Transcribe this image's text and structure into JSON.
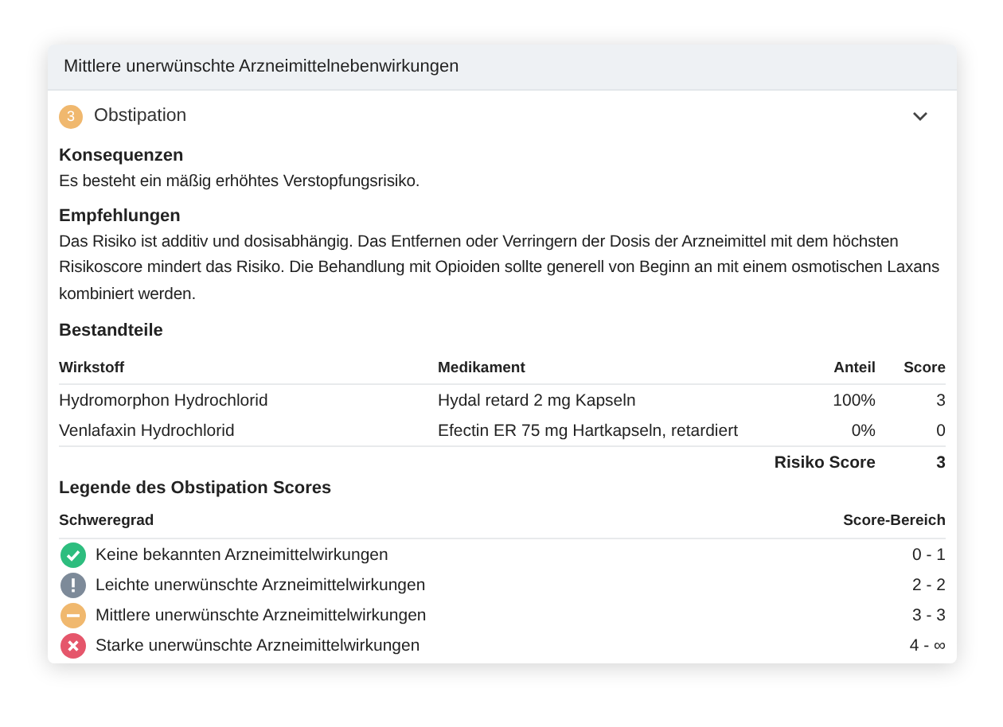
{
  "card": {
    "title": "Mittlere unerwünschte Arzneimittelnebenwirkungen"
  },
  "item": {
    "badge": "3",
    "title": "Obstipation",
    "expanded": true
  },
  "sections": [
    {
      "heading": "Konsequenzen",
      "text": "Es besteht ein mäßig erhöhtes Verstopfungsrisiko."
    },
    {
      "heading": "Empfehlungen",
      "text": "Das Risiko ist additiv und dosisabhängig. Das Entfernen oder Verringern der Dosis der Arzneimittel mit dem höchsten Risikoscore mindert das Risiko. Die Behandlung mit Opioiden sollte generell von Beginn an mit einem osmotischen Laxans kombiniert werden."
    }
  ],
  "components": {
    "heading": "Bestandteile",
    "columns": [
      "Wirkstoff",
      "Medikament",
      "Anteil",
      "Score"
    ],
    "rows": [
      [
        "Hydromorphon Hydrochlorid",
        "Hydal retard 2 mg Kapseln",
        "100%",
        "3"
      ],
      [
        "Venlafaxin Hydrochlorid",
        "Efectin ER 75 mg Hartkapseln, retardiert",
        "0%",
        "0"
      ]
    ],
    "total_label": "Risiko Score",
    "total": "3"
  },
  "legend": {
    "heading": "Legende des Obstipation Scores",
    "columns": [
      "Schweregrad",
      "Score-Bereich"
    ],
    "rows": [
      {
        "kind": "check",
        "color": "#2dbd7e",
        "label": "Keine bekannten Arzneimittelwirkungen",
        "range": "0 - 1"
      },
      {
        "kind": "exclamation",
        "color": "#7d8a99",
        "label": "Leichte unerwünschte Arzneimittelwirkungen",
        "range": "2 - 2"
      },
      {
        "kind": "minus",
        "color": "#f0b86e",
        "label": "Mittlere unerwünschte Arzneimittelwirkungen",
        "range": "3 - 3"
      },
      {
        "kind": "cross",
        "color": "#e5566b",
        "label": "Starke unerwünschte Arzneimittelwirkungen",
        "range": "4 - ∞"
      }
    ]
  }
}
